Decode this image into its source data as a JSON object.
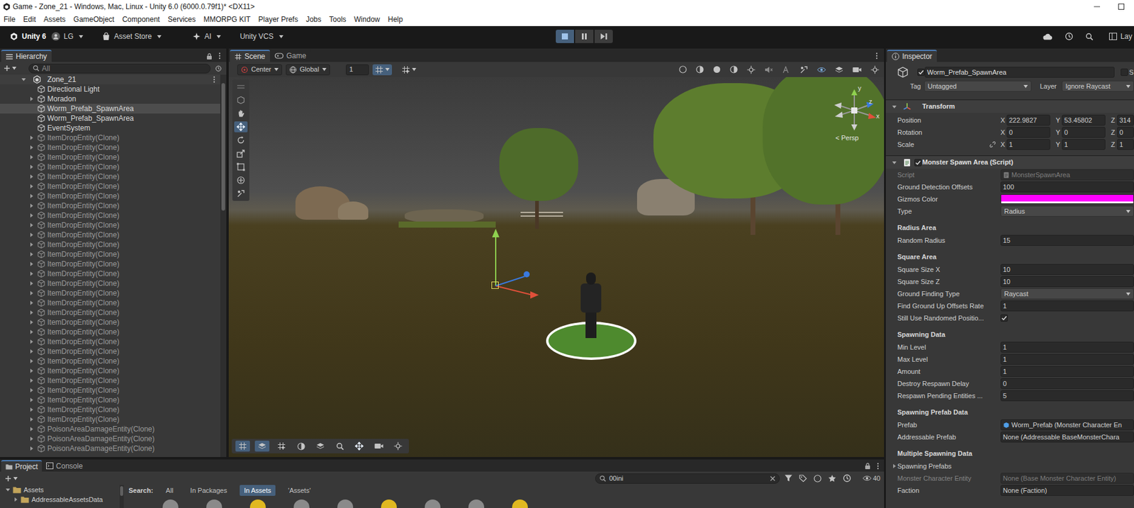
{
  "window": {
    "title": "Game - Zone_21 - Windows, Mac, Linux - Unity 6.0 (6000.0.79f1)* <DX11>"
  },
  "menu": [
    "File",
    "Edit",
    "Assets",
    "GameObject",
    "Component",
    "Services",
    "MMORPG KIT",
    "Player Prefs",
    "Jobs",
    "Tools",
    "Window",
    "Help"
  ],
  "toolbar": {
    "unity": "Unity 6",
    "account": "LG",
    "store": "Asset Store",
    "ai": "AI",
    "vcs": "Unity VCS",
    "playing": true,
    "paused": false,
    "layout": "Lay"
  },
  "hierarchy": {
    "title": "Hierarchy",
    "search": {
      "placeholder": "All"
    },
    "scene": {
      "label": "Zone_21",
      "expanded": true
    },
    "rows": [
      {
        "label": "Directional Light",
        "expandable": false,
        "selected": false,
        "dimmed": false
      },
      {
        "label": "Moradon",
        "expandable": true,
        "selected": false,
        "dimmed": false
      },
      {
        "label": "Worm_Prefab_SpawnArea",
        "expandable": false,
        "selected": true,
        "dimmed": false
      },
      {
        "label": "Worm_Prefab_SpawnArea",
        "expandable": false,
        "selected": false,
        "dimmed": false
      },
      {
        "label": "EventSystem",
        "expandable": false,
        "selected": false,
        "dimmed": false
      },
      {
        "label": "ItemDropEntity(Clone)",
        "expandable": true,
        "selected": false,
        "dimmed": true
      },
      {
        "label": "ItemDropEntity(Clone)",
        "expandable": true,
        "selected": false,
        "dimmed": true
      },
      {
        "label": "ItemDropEntity(Clone)",
        "expandable": true,
        "selected": false,
        "dimmed": true
      },
      {
        "label": "ItemDropEntity(Clone)",
        "expandable": true,
        "selected": false,
        "dimmed": true
      },
      {
        "label": "ItemDropEntity(Clone)",
        "expandable": true,
        "selected": false,
        "dimmed": true
      },
      {
        "label": "ItemDropEntity(Clone)",
        "expandable": true,
        "selected": false,
        "dimmed": true
      },
      {
        "label": "ItemDropEntity(Clone)",
        "expandable": true,
        "selected": false,
        "dimmed": true
      },
      {
        "label": "ItemDropEntity(Clone)",
        "expandable": true,
        "selected": false,
        "dimmed": true
      },
      {
        "label": "ItemDropEntity(Clone)",
        "expandable": true,
        "selected": false,
        "dimmed": true
      },
      {
        "label": "ItemDropEntity(Clone)",
        "expandable": true,
        "selected": false,
        "dimmed": true
      },
      {
        "label": "ItemDropEntity(Clone)",
        "expandable": true,
        "selected": false,
        "dimmed": true
      },
      {
        "label": "ItemDropEntity(Clone)",
        "expandable": true,
        "selected": false,
        "dimmed": true
      },
      {
        "label": "ItemDropEntity(Clone)",
        "expandable": true,
        "selected": false,
        "dimmed": true
      },
      {
        "label": "ItemDropEntity(Clone)",
        "expandable": true,
        "selected": false,
        "dimmed": true
      },
      {
        "label": "ItemDropEntity(Clone)",
        "expandable": true,
        "selected": false,
        "dimmed": true
      },
      {
        "label": "ItemDropEntity(Clone)",
        "expandable": true,
        "selected": false,
        "dimmed": true
      },
      {
        "label": "ItemDropEntity(Clone)",
        "expandable": true,
        "selected": false,
        "dimmed": true
      },
      {
        "label": "ItemDropEntity(Clone)",
        "expandable": true,
        "selected": false,
        "dimmed": true
      },
      {
        "label": "ItemDropEntity(Clone)",
        "expandable": true,
        "selected": false,
        "dimmed": true
      },
      {
        "label": "ItemDropEntity(Clone)",
        "expandable": true,
        "selected": false,
        "dimmed": true
      },
      {
        "label": "ItemDropEntity(Clone)",
        "expandable": true,
        "selected": false,
        "dimmed": true
      },
      {
        "label": "ItemDropEntity(Clone)",
        "expandable": true,
        "selected": false,
        "dimmed": true
      },
      {
        "label": "ItemDropEntity(Clone)",
        "expandable": true,
        "selected": false,
        "dimmed": true
      },
      {
        "label": "ItemDropEntity(Clone)",
        "expandable": true,
        "selected": false,
        "dimmed": true
      },
      {
        "label": "ItemDropEntity(Clone)",
        "expandable": true,
        "selected": false,
        "dimmed": true
      },
      {
        "label": "ItemDropEntity(Clone)",
        "expandable": true,
        "selected": false,
        "dimmed": true
      },
      {
        "label": "ItemDropEntity(Clone)",
        "expandable": true,
        "selected": false,
        "dimmed": true
      },
      {
        "label": "ItemDropEntity(Clone)",
        "expandable": true,
        "selected": false,
        "dimmed": true
      },
      {
        "label": "ItemDropEntity(Clone)",
        "expandable": true,
        "selected": false,
        "dimmed": true
      },
      {
        "label": "ItemDropEntity(Clone)",
        "expandable": true,
        "selected": false,
        "dimmed": true
      },
      {
        "label": "PoisonAreaDamageEntity(Clone)",
        "expandable": true,
        "selected": false,
        "dimmed": true
      },
      {
        "label": "PoisonAreaDamageEntity(Clone)",
        "expandable": true,
        "selected": false,
        "dimmed": true
      },
      {
        "label": "PoisonAreaDamageEntity(Clone)",
        "expandable": true,
        "selected": false,
        "dimmed": true
      }
    ]
  },
  "scene_view": {
    "tabs": [
      {
        "label": "Scene",
        "selected": true
      },
      {
        "label": "Game",
        "selected": false
      }
    ],
    "pivot": "Center",
    "space": "Global",
    "grid": "1",
    "camera": "< Persp",
    "axes": [
      "y",
      "z",
      "x"
    ]
  },
  "inspector": {
    "title": "Inspector",
    "object": {
      "active": true,
      "name": "Worm_Prefab_SpawnArea",
      "static_label": "S",
      "is_static": false
    },
    "tag": {
      "label": "Tag",
      "value": "Untagged"
    },
    "layer": {
      "label": "Layer",
      "value": "Ignore Raycast"
    },
    "transform": {
      "title": "Transform",
      "expanded": true,
      "rows": [
        {
          "label": "Position",
          "values": [
            {
              "axis": "X",
              "value": "222.9827"
            },
            {
              "axis": "Y",
              "value": "53.45802"
            },
            {
              "axis": "Z",
              "value": "314"
            }
          ]
        },
        {
          "label": "Rotation",
          "values": [
            {
              "axis": "X",
              "value": "0"
            },
            {
              "axis": "Y",
              "value": "0"
            },
            {
              "axis": "Z",
              "value": "0"
            }
          ]
        },
        {
          "label": "Scale",
          "linked": false,
          "values": [
            {
              "axis": "X",
              "value": "1"
            },
            {
              "axis": "Y",
              "value": "1"
            },
            {
              "axis": "Z",
              "value": "1"
            }
          ]
        }
      ]
    },
    "script": {
      "title": "Monster Spawn Area (Script)",
      "enabled": true,
      "expanded": true,
      "fields": [
        {
          "kind": "asset",
          "label": "Script",
          "value": "MonsterSpawnArea",
          "disabled": true
        },
        {
          "kind": "number",
          "label": "Ground Detection Offsets",
          "value": "100"
        },
        {
          "kind": "color",
          "label": "Gizmos Color",
          "color": "#ff00ff"
        },
        {
          "kind": "dropdown",
          "label": "Type",
          "value": "Radius"
        },
        {
          "kind": "header",
          "label": "Radius Area"
        },
        {
          "kind": "number",
          "label": "Random Radius",
          "value": "15"
        },
        {
          "kind": "header",
          "label": "Square Area"
        },
        {
          "kind": "number",
          "label": "Square Size X",
          "value": "10"
        },
        {
          "kind": "number",
          "label": "Square Size Z",
          "value": "10"
        },
        {
          "kind": "dropdown",
          "label": "Ground Finding Type",
          "value": "Raycast"
        },
        {
          "kind": "number",
          "label": "Find Ground Up Offsets Rate",
          "value": "1"
        },
        {
          "kind": "toggle",
          "label": "Still Use Randomed Positio...",
          "checked": true
        },
        {
          "kind": "header",
          "label": "Spawning Data"
        },
        {
          "kind": "number",
          "label": "Min Level",
          "value": "1"
        },
        {
          "kind": "number",
          "label": "Max Level",
          "value": "1"
        },
        {
          "kind": "number",
          "label": "Amount",
          "value": "1"
        },
        {
          "kind": "number",
          "label": "Destroy Respawn Delay",
          "value": "0"
        },
        {
          "kind": "number",
          "label": "Respawn Pending Entities ...",
          "value": "5"
        },
        {
          "kind": "header",
          "label": "Spawning Prefab Data"
        },
        {
          "kind": "asset",
          "label": "Prefab",
          "value": "Worm_Prefab (Monster Character En",
          "disabled": false
        },
        {
          "kind": "object",
          "label": "Addressable Prefab",
          "value": "None (Addressable BaseMonsterChara",
          "disabled": false
        },
        {
          "kind": "header",
          "label": "Multiple Spawning Data"
        },
        {
          "kind": "foldout",
          "label": "Spawning Prefabs",
          "expanded": false
        },
        {
          "kind": "object",
          "label": "Monster Character Entity",
          "value": "None (Base Monster Character Entity)",
          "disabled": true
        },
        {
          "kind": "object",
          "label": "Faction",
          "value": "None (Faction)",
          "disabled": false
        }
      ]
    }
  },
  "project": {
    "tabs": [
      {
        "label": "Project",
        "selected": true
      },
      {
        "label": "Console",
        "selected": false
      }
    ],
    "search": "00ini",
    "count": "40",
    "tree": [
      {
        "label": "Assets",
        "expanded": true
      },
      {
        "label": "AddressableAssetsData",
        "expanded": false
      }
    ],
    "scope": {
      "label": "Search:",
      "options": [
        {
          "label": "All",
          "selected": false
        },
        {
          "label": "In Packages",
          "selected": false
        },
        {
          "label": "In Assets",
          "selected": true
        },
        {
          "label": "'Assets'",
          "selected": false
        }
      ]
    }
  }
}
